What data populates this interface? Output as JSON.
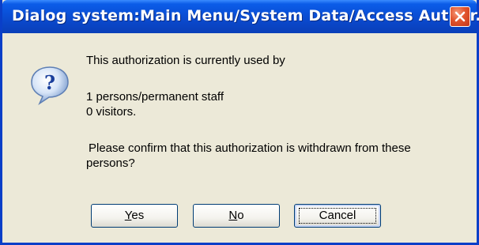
{
  "dialog": {
    "title": "Dialog system:Main Menu/System Data/Access Author..."
  },
  "message": {
    "line1": "This authorization is currently used by",
    "line2": "1 persons/permanent staff",
    "line3": "0 visitors.",
    "line4": "Please confirm that this authorization is withdrawn from these",
    "line5": "persons?"
  },
  "buttons": {
    "yes_accel": "Y",
    "yes_rest": "es",
    "no_accel": "N",
    "no_rest": "o",
    "cancel_label": "Cancel"
  },
  "icons": {
    "title_close": "close-icon",
    "message": "question-icon"
  },
  "colors": {
    "titlebar": "#0a4fd6",
    "dialog_bg": "#ece9d8",
    "close_button": "#e2542d"
  }
}
